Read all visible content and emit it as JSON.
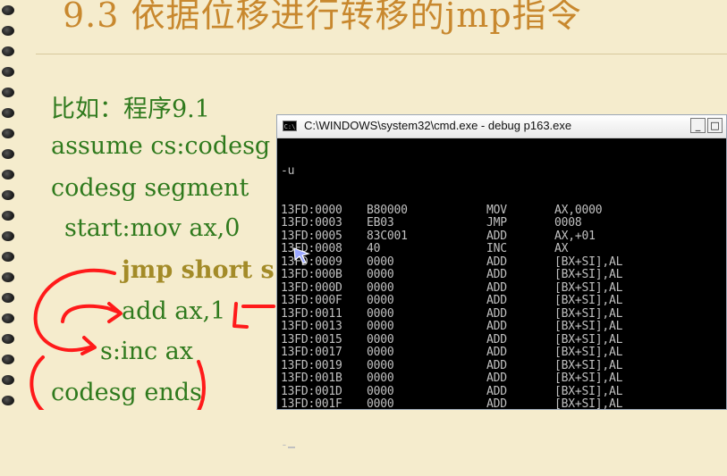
{
  "slide": {
    "title": "9.3 依据位移进行转移的jmp指令",
    "code_lines": [
      "比如：程序9.1",
      "assume cs:codesg",
      "codesg segment",
      "start:mov ax,0",
      "jmp short s",
      "add ax,1",
      "s:inc ax",
      "codesg ends"
    ]
  },
  "cmd": {
    "title": "C:\\WINDOWS\\system32\\cmd.exe - debug p163.exe",
    "icon_label": "C:\\",
    "buttons": [
      "_",
      "□"
    ],
    "prompt": "-u",
    "rows": [
      {
        "addr": "13FD:0000",
        "hex": "B80000",
        "mn": "MOV",
        "op": "AX,0000"
      },
      {
        "addr": "13FD:0003",
        "hex": "EB03",
        "mn": "JMP",
        "op": "0008"
      },
      {
        "addr": "13FD:0005",
        "hex": "83C001",
        "mn": "ADD",
        "op": "AX,+01"
      },
      {
        "addr": "13FD:0008",
        "hex": "40",
        "mn": "INC",
        "op": "AX"
      },
      {
        "addr": "13FD:0009",
        "hex": "0000",
        "mn": "ADD",
        "op": "[BX+SI],AL"
      },
      {
        "addr": "13FD:000B",
        "hex": "0000",
        "mn": "ADD",
        "op": "[BX+SI],AL"
      },
      {
        "addr": "13FD:000D",
        "hex": "0000",
        "mn": "ADD",
        "op": "[BX+SI],AL"
      },
      {
        "addr": "13FD:000F",
        "hex": "0000",
        "mn": "ADD",
        "op": "[BX+SI],AL"
      },
      {
        "addr": "13FD:0011",
        "hex": "0000",
        "mn": "ADD",
        "op": "[BX+SI],AL"
      },
      {
        "addr": "13FD:0013",
        "hex": "0000",
        "mn": "ADD",
        "op": "[BX+SI],AL"
      },
      {
        "addr": "13FD:0015",
        "hex": "0000",
        "mn": "ADD",
        "op": "[BX+SI],AL"
      },
      {
        "addr": "13FD:0017",
        "hex": "0000",
        "mn": "ADD",
        "op": "[BX+SI],AL"
      },
      {
        "addr": "13FD:0019",
        "hex": "0000",
        "mn": "ADD",
        "op": "[BX+SI],AL"
      },
      {
        "addr": "13FD:001B",
        "hex": "0000",
        "mn": "ADD",
        "op": "[BX+SI],AL"
      },
      {
        "addr": "13FD:001D",
        "hex": "0000",
        "mn": "ADD",
        "op": "[BX+SI],AL"
      },
      {
        "addr": "13FD:001F",
        "hex": "0000",
        "mn": "ADD",
        "op": "[BX+SI],AL"
      }
    ],
    "end_prompt": "-"
  },
  "colors": {
    "background": "#f5eccd",
    "title": "#c8882e",
    "code_green": "#2f7a1d",
    "code_olive": "#a38b28",
    "annotation_red": "#ff1a1a"
  }
}
